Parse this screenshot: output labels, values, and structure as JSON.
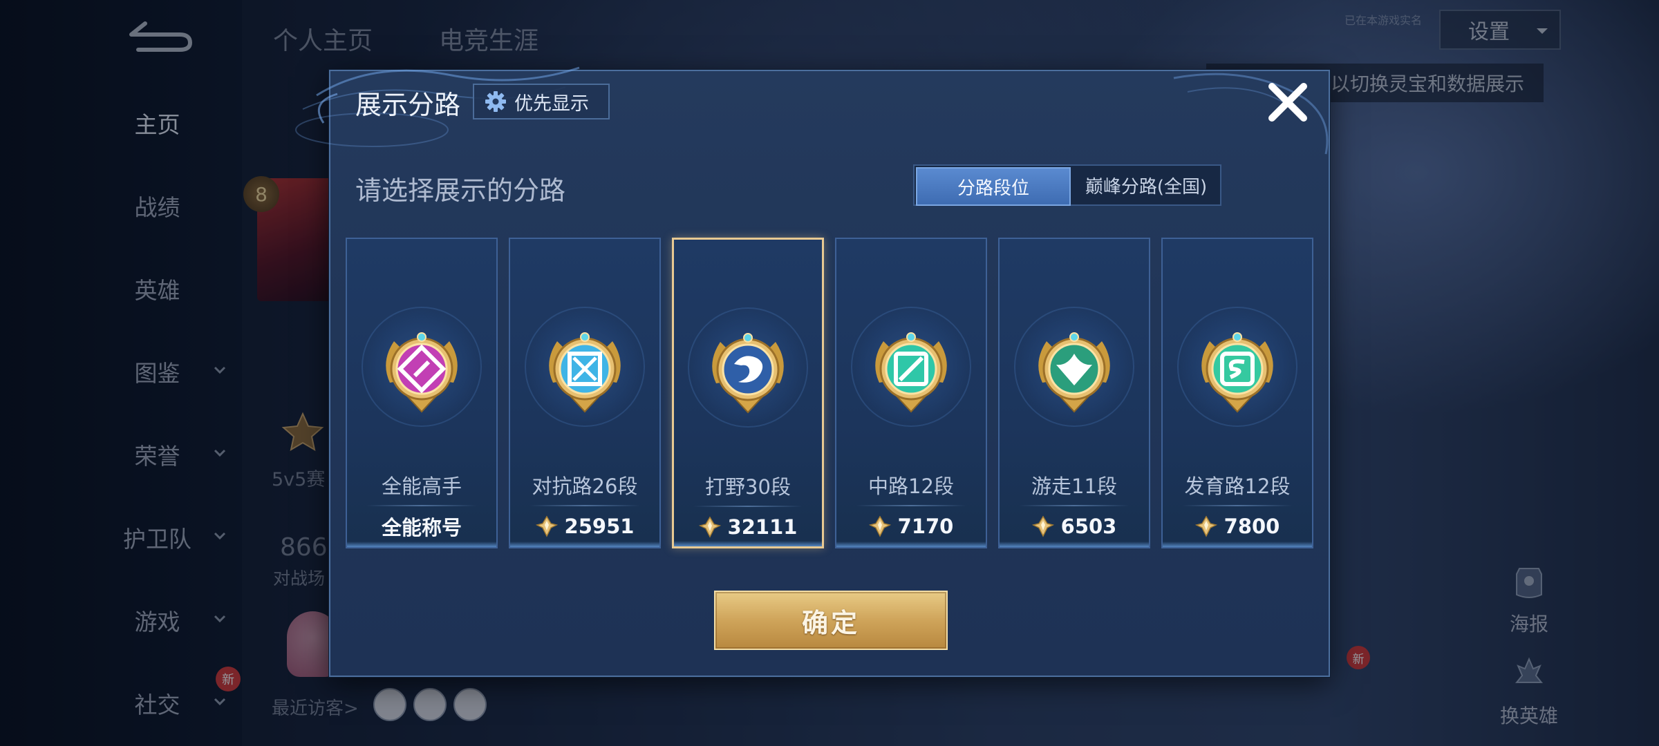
{
  "background": {
    "top_tabs": [
      "个人主页",
      "电竞生涯"
    ],
    "nav": [
      {
        "label": "主页",
        "has_chevron": false,
        "active": true
      },
      {
        "label": "战绩",
        "has_chevron": false
      },
      {
        "label": "英雄",
        "has_chevron": false
      },
      {
        "label": "图鉴",
        "has_chevron": true
      },
      {
        "label": "荣誉",
        "has_chevron": true
      },
      {
        "label": "护卫队",
        "has_chevron": true
      },
      {
        "label": "游戏",
        "has_chevron": true
      },
      {
        "label": "社交",
        "has_chevron": true
      }
    ],
    "new_badge": "新",
    "avatar_level": "8",
    "season_text": "5v5赛",
    "battles_number": "866",
    "battles_label": "对战场",
    "recent_visitors": "最近访客>",
    "settings_label": "设置",
    "tiny_label": "已在本游戏实名",
    "hint_text": "以切换灵宝和数据展示",
    "poster_label": "海报",
    "change_hero_label": "换英雄"
  },
  "modal": {
    "title": "展示分路",
    "priority_label": "优先显示",
    "prompt": "请选择展示的分路",
    "segments": [
      "分路段位",
      "巅峰分路(全国)"
    ],
    "active_segment": 0,
    "cards": [
      {
        "name": "全能高手",
        "value": "全能称号",
        "show_icon": false,
        "emblem": "all-round-emblem",
        "color": "#c23fb4"
      },
      {
        "name": "对抗路26段",
        "value": "25951",
        "show_icon": true,
        "emblem": "clash-lane-emblem",
        "color": "#3fb4e6"
      },
      {
        "name": "打野30段",
        "value": "32111",
        "show_icon": true,
        "emblem": "jungle-emblem",
        "color": "#2f5fa8"
      },
      {
        "name": "中路12段",
        "value": "7170",
        "show_icon": true,
        "emblem": "mid-lane-emblem",
        "color": "#2fc7a8"
      },
      {
        "name": "游走11段",
        "value": "6503",
        "show_icon": true,
        "emblem": "roam-emblem",
        "color": "#2b9e7c"
      },
      {
        "name": "发育路12段",
        "value": "7800",
        "show_icon": true,
        "emblem": "farm-lane-emblem",
        "color": "#35c9a0"
      }
    ],
    "selected_card": 2,
    "confirm_label": "确定"
  }
}
